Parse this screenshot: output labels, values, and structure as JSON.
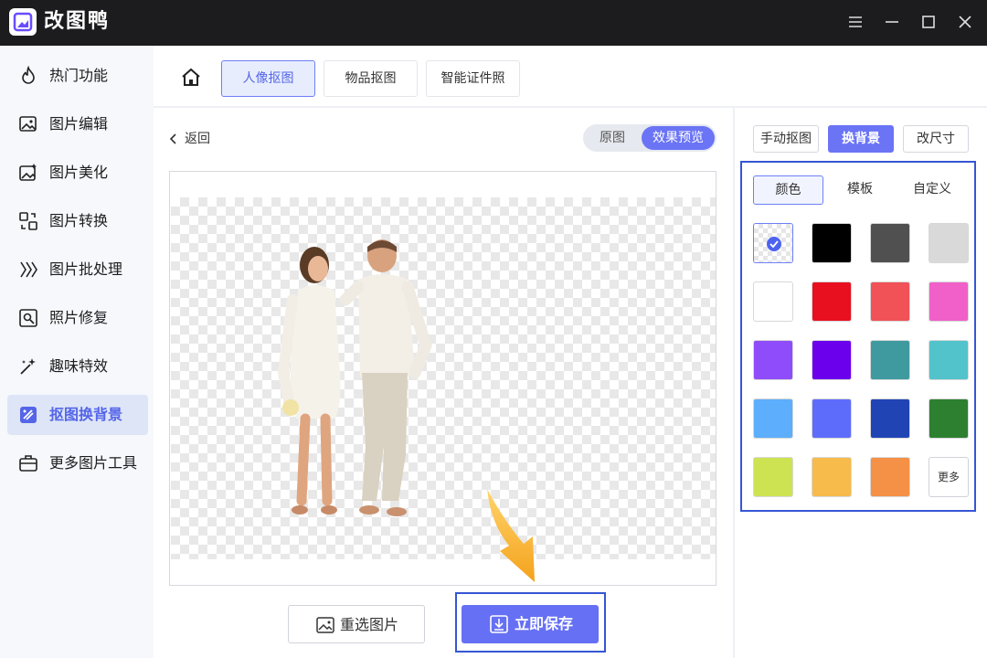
{
  "app": {
    "title": "改图鸭"
  },
  "window": {
    "menu_icon": "hamburger-icon",
    "min_icon": "minimize-icon",
    "max_icon": "maximize-icon",
    "close_icon": "close-icon"
  },
  "sidebar": {
    "items": [
      {
        "label": "热门功能",
        "icon": "flame-icon"
      },
      {
        "label": "图片编辑",
        "icon": "image-edit-icon"
      },
      {
        "label": "图片美化",
        "icon": "image-sparkle-icon"
      },
      {
        "label": "图片转换",
        "icon": "convert-icon"
      },
      {
        "label": "图片批处理",
        "icon": "batch-icon"
      },
      {
        "label": "照片修复",
        "icon": "repair-icon"
      },
      {
        "label": "趣味特效",
        "icon": "magic-wand-icon"
      },
      {
        "label": "抠图换背景",
        "icon": "cutout-icon",
        "active": true
      },
      {
        "label": "更多图片工具",
        "icon": "toolbox-icon"
      }
    ]
  },
  "top_tabs": {
    "home_icon": "home-icon",
    "items": [
      "人像抠图",
      "物品抠图",
      "智能证件照"
    ],
    "active": "人像抠图"
  },
  "main": {
    "back_label": "返回",
    "view_toggle": {
      "options": [
        "原图",
        "效果预览"
      ],
      "active": "效果预览"
    },
    "reselect_label": "重选图片",
    "save_label": "立即保存"
  },
  "right_panel": {
    "modes": [
      "手动抠图",
      "换背景",
      "改尺寸"
    ],
    "active_mode": "换背景",
    "sub_tabs": [
      "颜色",
      "模板",
      "自定义"
    ],
    "active_sub_tab": "颜色",
    "swatches": [
      "transparent",
      "#000000",
      "#505050",
      "#d9d9d9",
      "#ffffff",
      "#e8101f",
      "#f05258",
      "#f060c8",
      "#8f4cfa",
      "#6a00ec",
      "#3f9aa0",
      "#52c3cb",
      "#5daefc",
      "#5e6cfc",
      "#2044b4",
      "#2d8030",
      "#cde352",
      "#f6bb4a",
      "#f49146"
    ],
    "selected_swatch": "transparent",
    "more_label": "更多"
  },
  "colors": {
    "accent": "#6a74f5",
    "highlight": "#3556d4",
    "titlebar": "#1c1c1e"
  }
}
